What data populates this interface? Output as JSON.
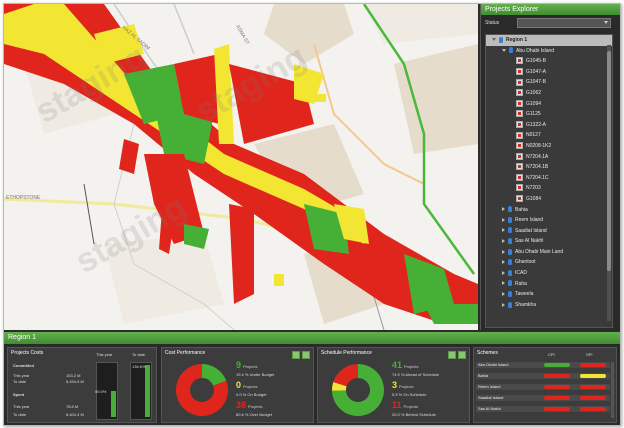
{
  "map": {
    "labels": {
      "road1": "HAZ AL SADIM",
      "road2": "ASMA ST",
      "road3": "ETHOPSTONE",
      "watermark1": "staging",
      "watermark2": "staging",
      "watermark3": "staging"
    }
  },
  "explorer": {
    "title": "Projects Explorer",
    "status_label": "Status",
    "region": "Region 1",
    "island": "Abu Dhabi Island",
    "projects": [
      "G1045-B",
      "G1047-A",
      "G1047-B",
      "G1062",
      "G1094",
      "G1125",
      "G1322-A",
      "N0127",
      "N0208-1K2",
      "N7204.1A",
      "N7204.1B",
      "N7204.1C",
      "N7203",
      "G1084"
    ],
    "areas": [
      "Bahia",
      "Reem Island",
      "Saadiat Island",
      "Sas Al Nakhl",
      "Abu Dhabi Main Land",
      "Ghantoot",
      "ICAD",
      "Raha",
      "Taweela",
      "Shamkha"
    ]
  },
  "region_bar": {
    "title": "Region 1"
  },
  "project_costs": {
    "title": "Projects Costs",
    "col_this_year": "This year",
    "col_to_date": "To date",
    "committed_label": "Committed",
    "committed_this_year_label": "This year",
    "committed_this_year": "153.2 M",
    "committed_to_date_label": "To date",
    "committed_to_date": "5,494.9 M",
    "spent_label": "Spent",
    "spent_this_year_label": "This year",
    "spent_this_year": "78.8 M",
    "spent_to_date_label": "To date",
    "spent_to_date": "8,404.4 M",
    "gauge_this_year_label": "50.0%",
    "gauge_to_date_label": "136.6%",
    "gauge_this_year_fraction": 0.5,
    "gauge_to_date_fraction": 1.0
  },
  "cost_performance": {
    "title": "Cost Performance",
    "under_count": "9",
    "under_unit": "Projects",
    "under_text": "19.4 % Under Budget",
    "on_count": "0",
    "on_unit": "Projects",
    "on_text": "0.0 % On Budget",
    "over_count": "38",
    "over_unit": "Projects",
    "over_text": "80.6 % Over Budget"
  },
  "schedule_performance": {
    "title": "Schedule Performance",
    "ahead_count": "41",
    "ahead_unit": "Projects",
    "ahead_text": "74.5 % Ahead of Schedule",
    "on_count": "3",
    "on_unit": "Projects",
    "on_text": "5.5 % On Schedule",
    "behind_count": "11",
    "behind_unit": "Projects",
    "behind_text": "20.0 % Behind Schedule"
  },
  "schemes": {
    "title": "Schemes",
    "col1": "CPI",
    "col2": "SPI",
    "rows": [
      "Abu Dhabi Island",
      "Bahia",
      "Reem Island",
      "Saadiat Island",
      "Sas Al Nakhl"
    ]
  },
  "colors": {
    "green": "#45b035",
    "red": "#e0261c",
    "yellow": "#f2e633",
    "accent": "#4a9a38"
  }
}
